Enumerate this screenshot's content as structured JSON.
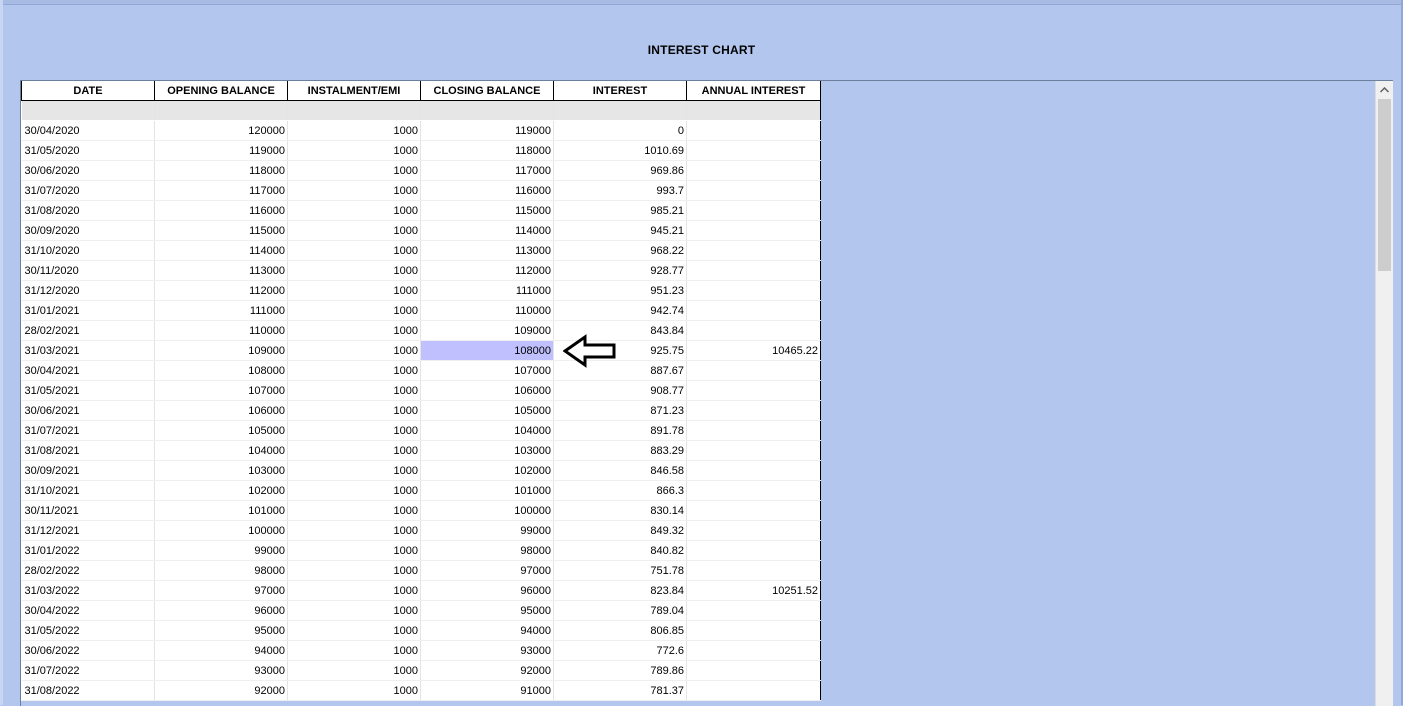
{
  "title": "INTEREST CHART",
  "columns": [
    "DATE",
    "OPENING BALANCE",
    "INSTALMENT/EMI",
    "CLOSING BALANCE",
    "INTEREST",
    "ANNUAL INTEREST"
  ],
  "rows": [
    [
      "30/04/2020",
      "120000",
      "1000",
      "119000",
      "0",
      ""
    ],
    [
      "31/05/2020",
      "119000",
      "1000",
      "118000",
      "1010.69",
      ""
    ],
    [
      "30/06/2020",
      "118000",
      "1000",
      "117000",
      "969.86",
      ""
    ],
    [
      "31/07/2020",
      "117000",
      "1000",
      "116000",
      "993.7",
      ""
    ],
    [
      "31/08/2020",
      "116000",
      "1000",
      "115000",
      "985.21",
      ""
    ],
    [
      "30/09/2020",
      "115000",
      "1000",
      "114000",
      "945.21",
      ""
    ],
    [
      "31/10/2020",
      "114000",
      "1000",
      "113000",
      "968.22",
      ""
    ],
    [
      "30/11/2020",
      "113000",
      "1000",
      "112000",
      "928.77",
      ""
    ],
    [
      "31/12/2020",
      "112000",
      "1000",
      "111000",
      "951.23",
      ""
    ],
    [
      "31/01/2021",
      "111000",
      "1000",
      "110000",
      "942.74",
      ""
    ],
    [
      "28/02/2021",
      "110000",
      "1000",
      "109000",
      "843.84",
      ""
    ],
    [
      "31/03/2021",
      "109000",
      "1000",
      "108000",
      "925.75",
      "10465.22"
    ],
    [
      "30/04/2021",
      "108000",
      "1000",
      "107000",
      "887.67",
      ""
    ],
    [
      "31/05/2021",
      "107000",
      "1000",
      "106000",
      "908.77",
      ""
    ],
    [
      "30/06/2021",
      "106000",
      "1000",
      "105000",
      "871.23",
      ""
    ],
    [
      "31/07/2021",
      "105000",
      "1000",
      "104000",
      "891.78",
      ""
    ],
    [
      "31/08/2021",
      "104000",
      "1000",
      "103000",
      "883.29",
      ""
    ],
    [
      "30/09/2021",
      "103000",
      "1000",
      "102000",
      "846.58",
      ""
    ],
    [
      "31/10/2021",
      "102000",
      "1000",
      "101000",
      "866.3",
      ""
    ],
    [
      "30/11/2021",
      "101000",
      "1000",
      "100000",
      "830.14",
      ""
    ],
    [
      "31/12/2021",
      "100000",
      "1000",
      "99000",
      "849.32",
      ""
    ],
    [
      "31/01/2022",
      "99000",
      "1000",
      "98000",
      "840.82",
      ""
    ],
    [
      "28/02/2022",
      "98000",
      "1000",
      "97000",
      "751.78",
      ""
    ],
    [
      "31/03/2022",
      "97000",
      "1000",
      "96000",
      "823.84",
      "10251.52"
    ],
    [
      "30/04/2022",
      "96000",
      "1000",
      "95000",
      "789.04",
      ""
    ],
    [
      "31/05/2022",
      "95000",
      "1000",
      "94000",
      "806.85",
      ""
    ],
    [
      "30/06/2022",
      "94000",
      "1000",
      "93000",
      "772.6",
      ""
    ],
    [
      "31/07/2022",
      "93000",
      "1000",
      "92000",
      "789.86",
      ""
    ],
    [
      "31/08/2022",
      "92000",
      "1000",
      "91000",
      "781.37",
      ""
    ]
  ],
  "selected_cell": {
    "row": 11,
    "column": 3
  },
  "colors": {
    "background": "#b3c7ee",
    "selection": "#c0c0ff",
    "grid_line": "#e4e4e4"
  },
  "icons": {
    "pointer": "arrow-left-icon",
    "scroll_up": "chevron-up-icon"
  }
}
